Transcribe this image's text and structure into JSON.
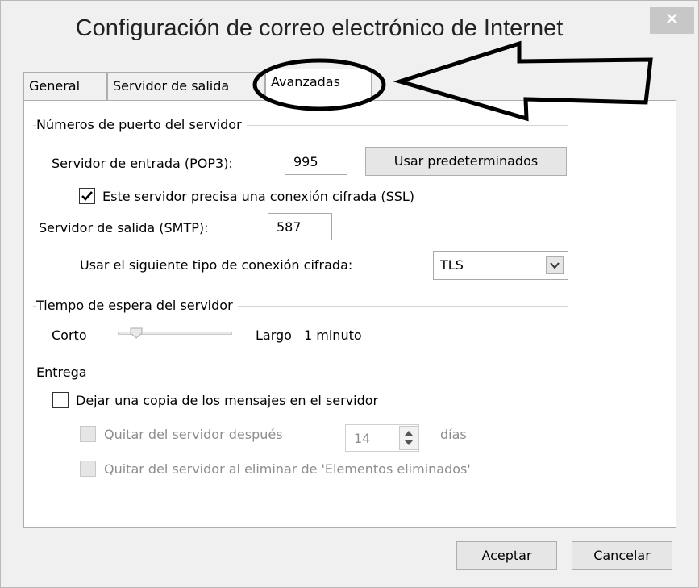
{
  "window": {
    "title": "Configuración de correo electrónico de Internet",
    "close_glyph": "✕"
  },
  "tabs": [
    {
      "label": "General"
    },
    {
      "label": "Servidor de salida"
    },
    {
      "label": "Avanzadas"
    }
  ],
  "ports": {
    "group_title": "Números de puerto del servidor",
    "incoming_label": "Servidor de entrada (POP3):",
    "incoming_value": "995",
    "defaults_button": "Usar predeterminados",
    "ssl_label": "Este servidor precisa una conexión cifrada (SSL)",
    "ssl_checked": true,
    "outgoing_label": "Servidor de salida (SMTP):",
    "outgoing_value": "587",
    "encryption_label": "Usar el siguiente tipo de conexión cifrada:",
    "encryption_value": "TLS"
  },
  "timeout": {
    "group_title": "Tiempo de espera del servidor",
    "short_label": "Corto",
    "long_label": "Largo",
    "value_text": "1 minuto"
  },
  "delivery": {
    "group_title": "Entrega",
    "leave_copy_label": "Dejar una copia de los mensajes en el servidor",
    "leave_copy_checked": false,
    "remove_after_label": "Quitar del servidor después",
    "remove_after_days": "14",
    "days_unit": "días",
    "remove_on_delete_label": "Quitar del servidor al eliminar de 'Elementos eliminados'"
  },
  "footer": {
    "ok_button": "Aceptar",
    "cancel_button": "Cancelar"
  },
  "colors": {
    "annotation": "#000000",
    "close_bg": "#c7c7c7",
    "disabled_text": "#8d8d8d"
  },
  "icons": {
    "close": "close-icon",
    "checkmark": "checkmark-icon",
    "dropdown": "chevron-down-icon",
    "slider": "slider-thumb-icon",
    "spinner": "spinner-arrows-icon"
  }
}
